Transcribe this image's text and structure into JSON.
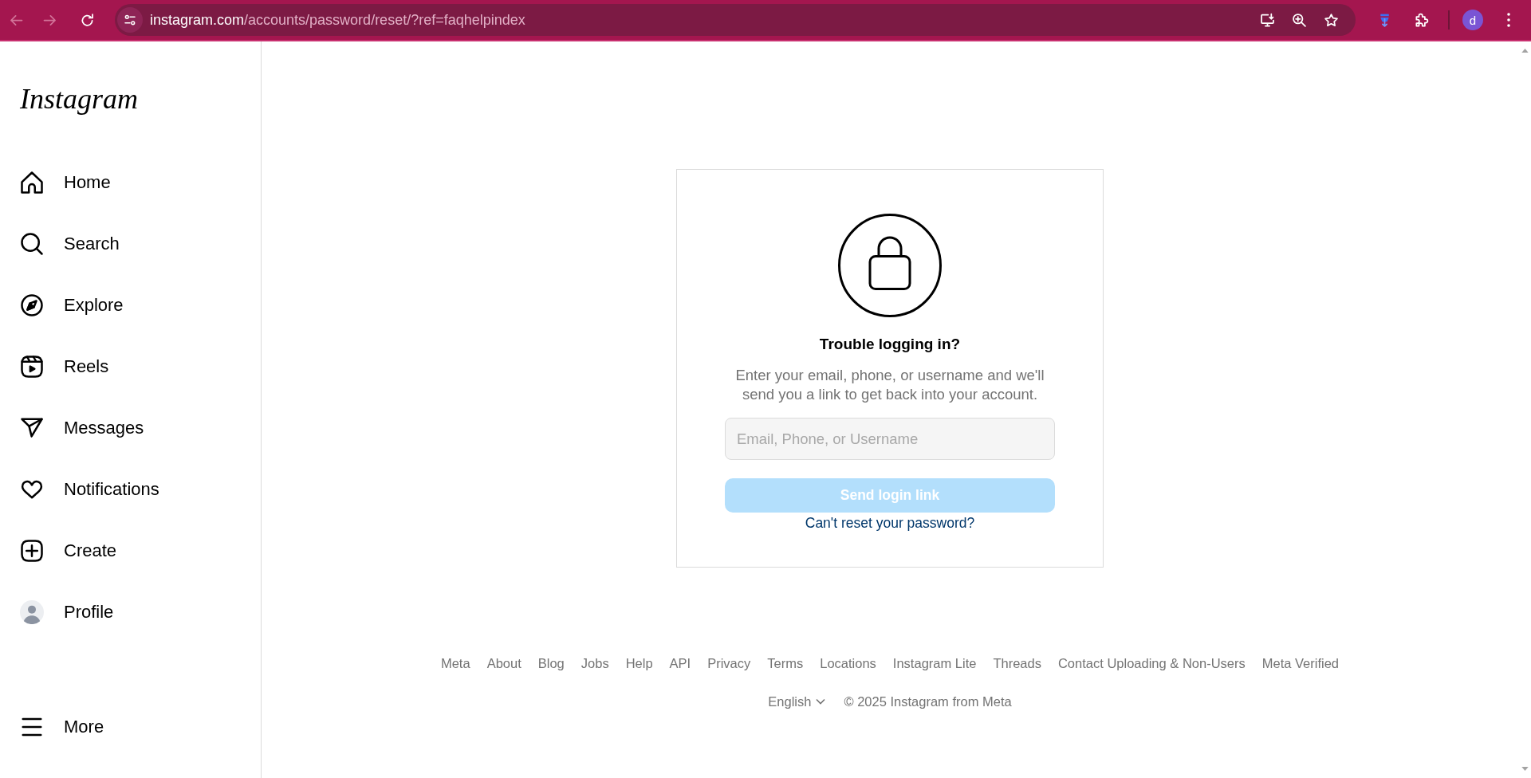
{
  "browser": {
    "back": {
      "disabled": true
    },
    "forward": {
      "disabled": true
    },
    "url": "instagram.com/accounts/password/reset/?ref=faqhelpindex",
    "profile_initial": "d"
  },
  "sidebar": {
    "logo": "Instagram",
    "items": [
      {
        "kind": "home",
        "label": "Home",
        "selected": false
      },
      {
        "kind": "search",
        "label": "Search",
        "selected": false
      },
      {
        "kind": "explore",
        "label": "Explore",
        "selected": false
      },
      {
        "kind": "reels",
        "label": "Reels",
        "selected": false
      },
      {
        "kind": "messages",
        "label": "Messages",
        "selected": false
      },
      {
        "kind": "notifications",
        "label": "Notifications",
        "selected": false
      },
      {
        "kind": "create",
        "label": "Create",
        "selected": false
      },
      {
        "kind": "profile",
        "label": "Profile",
        "selected": false
      }
    ],
    "more": {
      "label": "More"
    }
  },
  "card": {
    "title": "Trouble logging in?",
    "description": "Enter your email, phone, or username and we'll send you a link to get back into your account.",
    "input": {
      "placeholder": "Email, Phone, or Username"
    },
    "button": {
      "label": "Send login link",
      "disabled": true
    },
    "link": "Can't reset your password?"
  },
  "footer": {
    "links": [
      "Meta",
      "About",
      "Blog",
      "Jobs",
      "Help",
      "API",
      "Privacy",
      "Terms",
      "Locations",
      "Instagram Lite",
      "Threads",
      "Contact Uploading & Non-Users",
      "Meta Verified"
    ],
    "language": "English",
    "copyright": "© 2025 Instagram from Meta"
  }
}
